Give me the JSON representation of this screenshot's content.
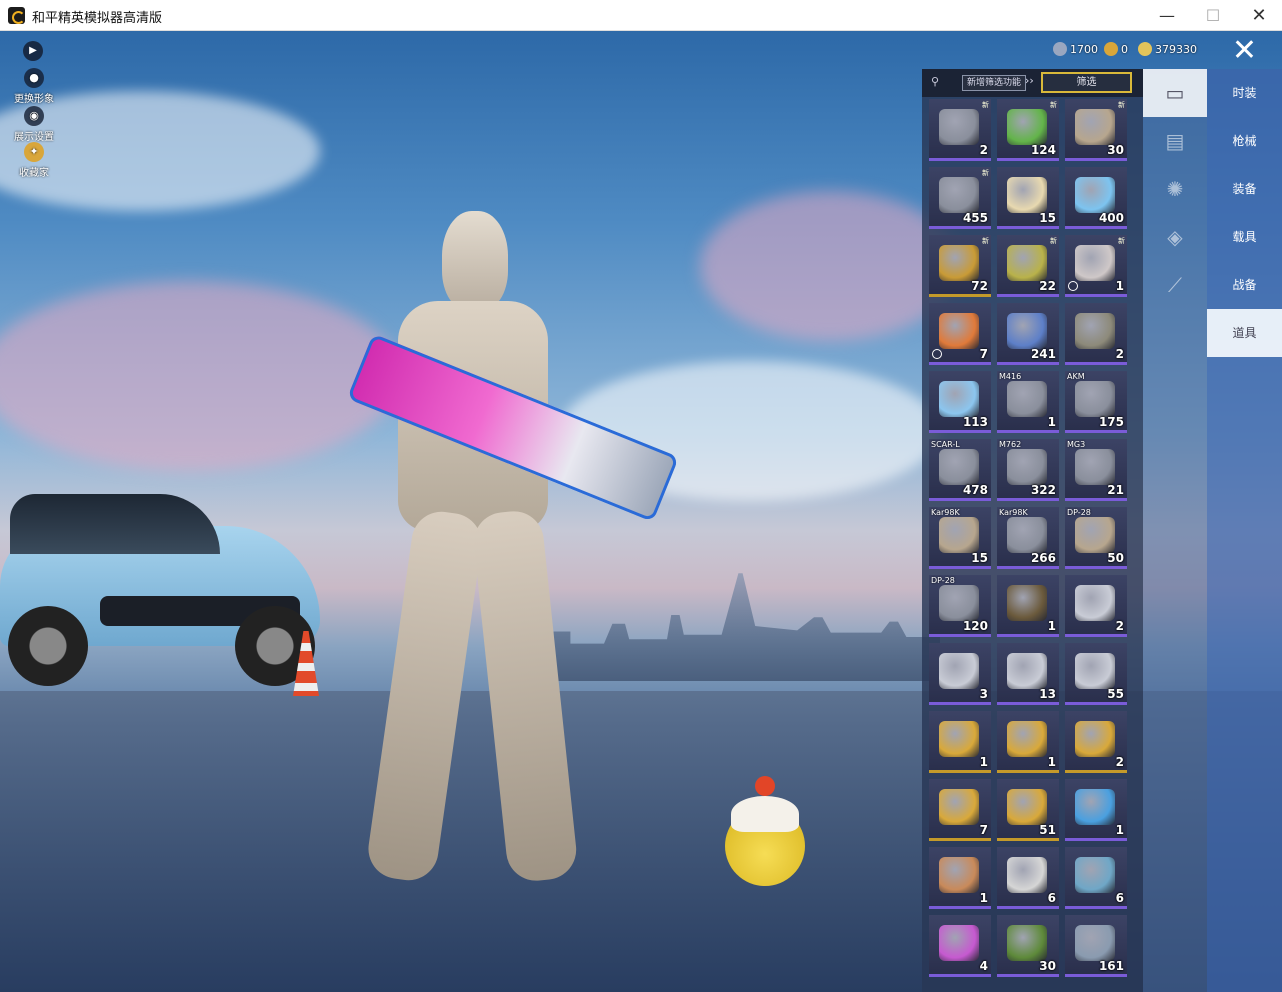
{
  "window": {
    "title": "和平精英模拟器高清版",
    "minimize": "—",
    "maximize": "☐",
    "close": "✕"
  },
  "left_menu": [
    {
      "label": "更换形象",
      "icon": "avatar-icon"
    },
    {
      "label": "展示设置",
      "icon": "eye-icon"
    },
    {
      "label": "收藏家",
      "icon": "collector-badge-icon"
    }
  ],
  "currency": [
    {
      "value": "1700",
      "icon": "coupon-icon",
      "color": "#9aa7c0"
    },
    {
      "value": "0",
      "icon": "token-icon",
      "color": "#d9a63a"
    },
    {
      "value": "379330",
      "icon": "coin-icon",
      "color": "#e3c45a"
    }
  ],
  "inventory": {
    "new_filter_label": "新增筛选功能",
    "filter_label": "筛选",
    "items": [
      {
        "name": "spring-part",
        "count": "2",
        "tag": "",
        "new": "新",
        "clock": false,
        "color": "#8a8f9c"
      },
      {
        "name": "battery-can",
        "count": "124",
        "tag": "",
        "new": "新",
        "clock": false,
        "color": "#63b44a"
      },
      {
        "name": "crate",
        "count": "30",
        "tag": "",
        "new": "新",
        "clock": false,
        "color": "#b7a68e"
      },
      {
        "name": "spring-part",
        "count": "455",
        "tag": "",
        "new": "新",
        "clock": false,
        "color": "#8a8f9c"
      },
      {
        "name": "compass",
        "count": "15",
        "tag": "",
        "new": "",
        "clock": false,
        "color": "#e8d9b0"
      },
      {
        "name": "crystal",
        "count": "400",
        "tag": "",
        "new": "",
        "clock": false,
        "color": "#7dc4f0"
      },
      {
        "name": "gold-card",
        "count": "72",
        "tag": "",
        "new": "新",
        "clock": false,
        "color": "#c99b36"
      },
      {
        "name": "grenade",
        "count": "22",
        "tag": "",
        "new": "新",
        "clock": false,
        "color": "#b9b24a"
      },
      {
        "name": "ticket",
        "count": "1",
        "tag": "",
        "new": "新",
        "clock": true,
        "color": "#cfc8c8"
      },
      {
        "name": "medal-star",
        "count": "7",
        "tag": "",
        "new": "",
        "clock": true,
        "color": "#e07a3a"
      },
      {
        "name": "spray-can",
        "count": "241",
        "tag": "",
        "new": "",
        "clock": false,
        "color": "#5d7fc8"
      },
      {
        "name": "weapon-box",
        "count": "2",
        "tag": "",
        "new": "",
        "clock": false,
        "color": "#8d8a7a"
      },
      {
        "name": "blue-orb",
        "count": "113",
        "tag": "",
        "new": "",
        "clock": false,
        "color": "#8cc6ef"
      },
      {
        "name": "spring-part",
        "count": "1",
        "tag": "M416",
        "new": "",
        "clock": false,
        "color": "#8a8f9c"
      },
      {
        "name": "spring-part",
        "count": "175",
        "tag": "AKM",
        "new": "",
        "clock": false,
        "color": "#8a8f9c"
      },
      {
        "name": "spring-part",
        "count": "478",
        "tag": "SCAR-L",
        "new": "",
        "clock": false,
        "color": "#8a8f9c"
      },
      {
        "name": "spring-part",
        "count": "322",
        "tag": "M762",
        "new": "",
        "clock": false,
        "color": "#8a8f9c"
      },
      {
        "name": "spring-part",
        "count": "21",
        "tag": "MG3",
        "new": "",
        "clock": false,
        "color": "#8a8f9c"
      },
      {
        "name": "crate",
        "count": "15",
        "tag": "Kar98K",
        "new": "",
        "clock": false,
        "color": "#b7a68e"
      },
      {
        "name": "spring-part",
        "count": "266",
        "tag": "Kar98K",
        "new": "",
        "clock": false,
        "color": "#8a8f9c"
      },
      {
        "name": "crate",
        "count": "50",
        "tag": "DP-28",
        "new": "",
        "clock": false,
        "color": "#b7a68e"
      },
      {
        "name": "spring-part",
        "count": "120",
        "tag": "DP-28",
        "new": "",
        "clock": false,
        "color": "#8a8f9c"
      },
      {
        "name": "book",
        "count": "1",
        "tag": "",
        "new": "",
        "clock": false,
        "color": "#6b5a3c"
      },
      {
        "name": "silver-card",
        "count": "2",
        "tag": "",
        "new": "",
        "clock": false,
        "color": "#c9ccd6"
      },
      {
        "name": "silver-card",
        "count": "3",
        "tag": "",
        "new": "",
        "clock": false,
        "color": "#c9ccd6"
      },
      {
        "name": "silver-card",
        "count": "13",
        "tag": "",
        "new": "",
        "clock": false,
        "color": "#c9ccd6"
      },
      {
        "name": "silver-card",
        "count": "55",
        "tag": "",
        "new": "",
        "clock": false,
        "color": "#c9ccd6"
      },
      {
        "name": "gold-card",
        "count": "1",
        "tag": "",
        "new": "",
        "clock": false,
        "color": "#d9a93a"
      },
      {
        "name": "gold-card",
        "count": "1",
        "tag": "",
        "new": "",
        "clock": false,
        "color": "#d9a93a"
      },
      {
        "name": "gold-card",
        "count": "2",
        "tag": "",
        "new": "",
        "clock": false,
        "color": "#d9a93a"
      },
      {
        "name": "gold-card",
        "count": "7",
        "tag": "",
        "new": "",
        "clock": false,
        "color": "#d9a93a"
      },
      {
        "name": "gold-card",
        "count": "51",
        "tag": "",
        "new": "",
        "clock": false,
        "color": "#d9a93a"
      },
      {
        "name": "puzzle-orb",
        "count": "1",
        "tag": "",
        "new": "",
        "clock": false,
        "color": "#4aa0e0"
      },
      {
        "name": "hands-badge",
        "count": "1",
        "tag": "",
        "new": "",
        "clock": false,
        "color": "#c98a5a"
      },
      {
        "name": "key",
        "count": "6",
        "tag": "",
        "new": "",
        "clock": false,
        "color": "#d6d6d6"
      },
      {
        "name": "card-pack",
        "count": "6",
        "tag": "",
        "new": "",
        "clock": false,
        "color": "#6fa7c7"
      },
      {
        "name": "spray-can-pink",
        "count": "4",
        "tag": "",
        "new": "",
        "clock": false,
        "color": "#c65ad0"
      },
      {
        "name": "fuel-can",
        "count": "30",
        "tag": "",
        "new": "",
        "clock": false,
        "color": "#5e8a3a"
      },
      {
        "name": "spray-gun",
        "count": "161",
        "tag": "",
        "new": "",
        "clock": false,
        "color": "#8a9bb0"
      }
    ]
  },
  "category_icons": [
    "card-icon",
    "calendar-icon",
    "burst-icon",
    "ticket-icon",
    "rifle-icon"
  ],
  "tabs": [
    {
      "label": "时装",
      "active": false
    },
    {
      "label": "枪械",
      "active": false
    },
    {
      "label": "装备",
      "active": false
    },
    {
      "label": "载具",
      "active": false
    },
    {
      "label": "战备",
      "active": false
    },
    {
      "label": "道具",
      "active": true
    }
  ]
}
